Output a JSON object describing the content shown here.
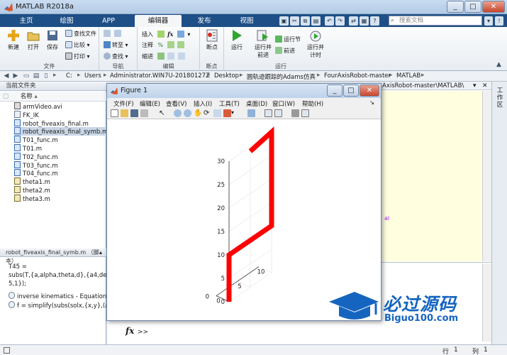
{
  "app": {
    "title": "MATLAB R2018a",
    "window_controls": [
      "_",
      "□",
      "✕"
    ]
  },
  "tabs": [
    {
      "label": "主页"
    },
    {
      "label": "绘图"
    },
    {
      "label": "APP"
    },
    {
      "label": "编辑器"
    },
    {
      "label": "发布"
    },
    {
      "label": "视图"
    }
  ],
  "search": {
    "placeholder": "搜索文档"
  },
  "ribbon": {
    "file": {
      "label": "文件",
      "new": "新建",
      "open": "打开",
      "save": "保存",
      "find_files": "查找文件",
      "compare": "比较",
      "print": "打印"
    },
    "navigate": {
      "label": "导航",
      "goto": "转至",
      "find": "查找"
    },
    "edit": {
      "label": "编辑",
      "insert": "插入",
      "comment": "注释",
      "indent": "缩进",
      "fx": "fx"
    },
    "breakpoints": {
      "label": "断点",
      "breakpoints_btn": "断点"
    },
    "run": {
      "label": "运行",
      "run": "运行",
      "run_advance": "运行并\n前进",
      "run_section": "运行节",
      "advance": "前进",
      "run_time": "运行并\n计时"
    }
  },
  "address": {
    "crumbs": [
      "C:",
      "Users",
      "Administrator.WIN7U-20180127Z",
      "Desktop",
      "圆轨迹跟踪的Adams仿真",
      "FourAxisRobot-master",
      "MATLAB"
    ]
  },
  "current_folder": {
    "title": "当前文件夹",
    "column_name": "名称",
    "files": [
      {
        "name": "armVideo.avi",
        "type": "avi"
      },
      {
        "name": "FK_IK",
        "type": "other"
      },
      {
        "name": "robot_fiveaxis_final.m",
        "type": "m"
      },
      {
        "name": "robot_fiveaxis_final_symb.m",
        "type": "m",
        "selected": true
      },
      {
        "name": "T01_func.m",
        "type": "m"
      },
      {
        "name": "T01.m",
        "type": "m"
      },
      {
        "name": "T02_func.m",
        "type": "m"
      },
      {
        "name": "T03_func.m",
        "type": "m"
      },
      {
        "name": "T04_func.m",
        "type": "m"
      },
      {
        "name": "theta1.m",
        "type": "mat"
      },
      {
        "name": "theta2.m",
        "type": "mat"
      },
      {
        "name": "theta3.m",
        "type": "mat"
      }
    ]
  },
  "details": {
    "title": "robot_fiveaxis_final_symb.m （脚本）",
    "lines": [
      "T45 =",
      "subs(T,{a,alpha,theta,d},{a4,delta5,th",
      "5,1});"
    ],
    "item1": "inverse kinematics - Equation 1",
    "item2": "f = simplify(subs(solx,{x,y},(a1+a"
  },
  "editor_path_fragment": "AxisRobot-master\\MATLAB\\",
  "editor_snippet": "al",
  "command_prompt": {
    "fx": "fx",
    "prompt": ">>"
  },
  "statusbar": {
    "row_label": "行",
    "row_value": "1",
    "col_label": "列",
    "col_value": "1"
  },
  "right_strip_label": "工作区",
  "figure": {
    "title": "Figure 1",
    "menu": [
      "文件(F)",
      "编辑(E)",
      "查看(V)",
      "插入(I)",
      "工具(T)",
      "桌面(D)",
      "窗口(W)",
      "帮助(H)"
    ]
  },
  "chart_data": {
    "type": "line",
    "projection": "3d",
    "series": [
      {
        "color": "#ff0000",
        "x": [
          0,
          0,
          0,
          0,
          0,
          0,
          0
        ],
        "y": [
          0,
          0,
          5,
          10,
          10,
          10,
          5
        ],
        "z": [
          0,
          10,
          10,
          10,
          30,
          30,
          29
        ],
        "note_points": "red thick polyline in 3D"
      }
    ],
    "z_ticks": [
      0,
      5,
      10,
      15,
      20,
      25,
      30
    ],
    "y_ticks": [
      0,
      5,
      10
    ],
    "x_ticks": [
      0
    ],
    "zlim": [
      0,
      30
    ],
    "grid": true
  },
  "watermark": {
    "title": "必过源码",
    "url": "Biguo100.com"
  },
  "colors": {
    "ribbon_tab_bg": "#1e4f86",
    "plot_line": "#ff0000",
    "watermark_blue": "#1565c0"
  }
}
